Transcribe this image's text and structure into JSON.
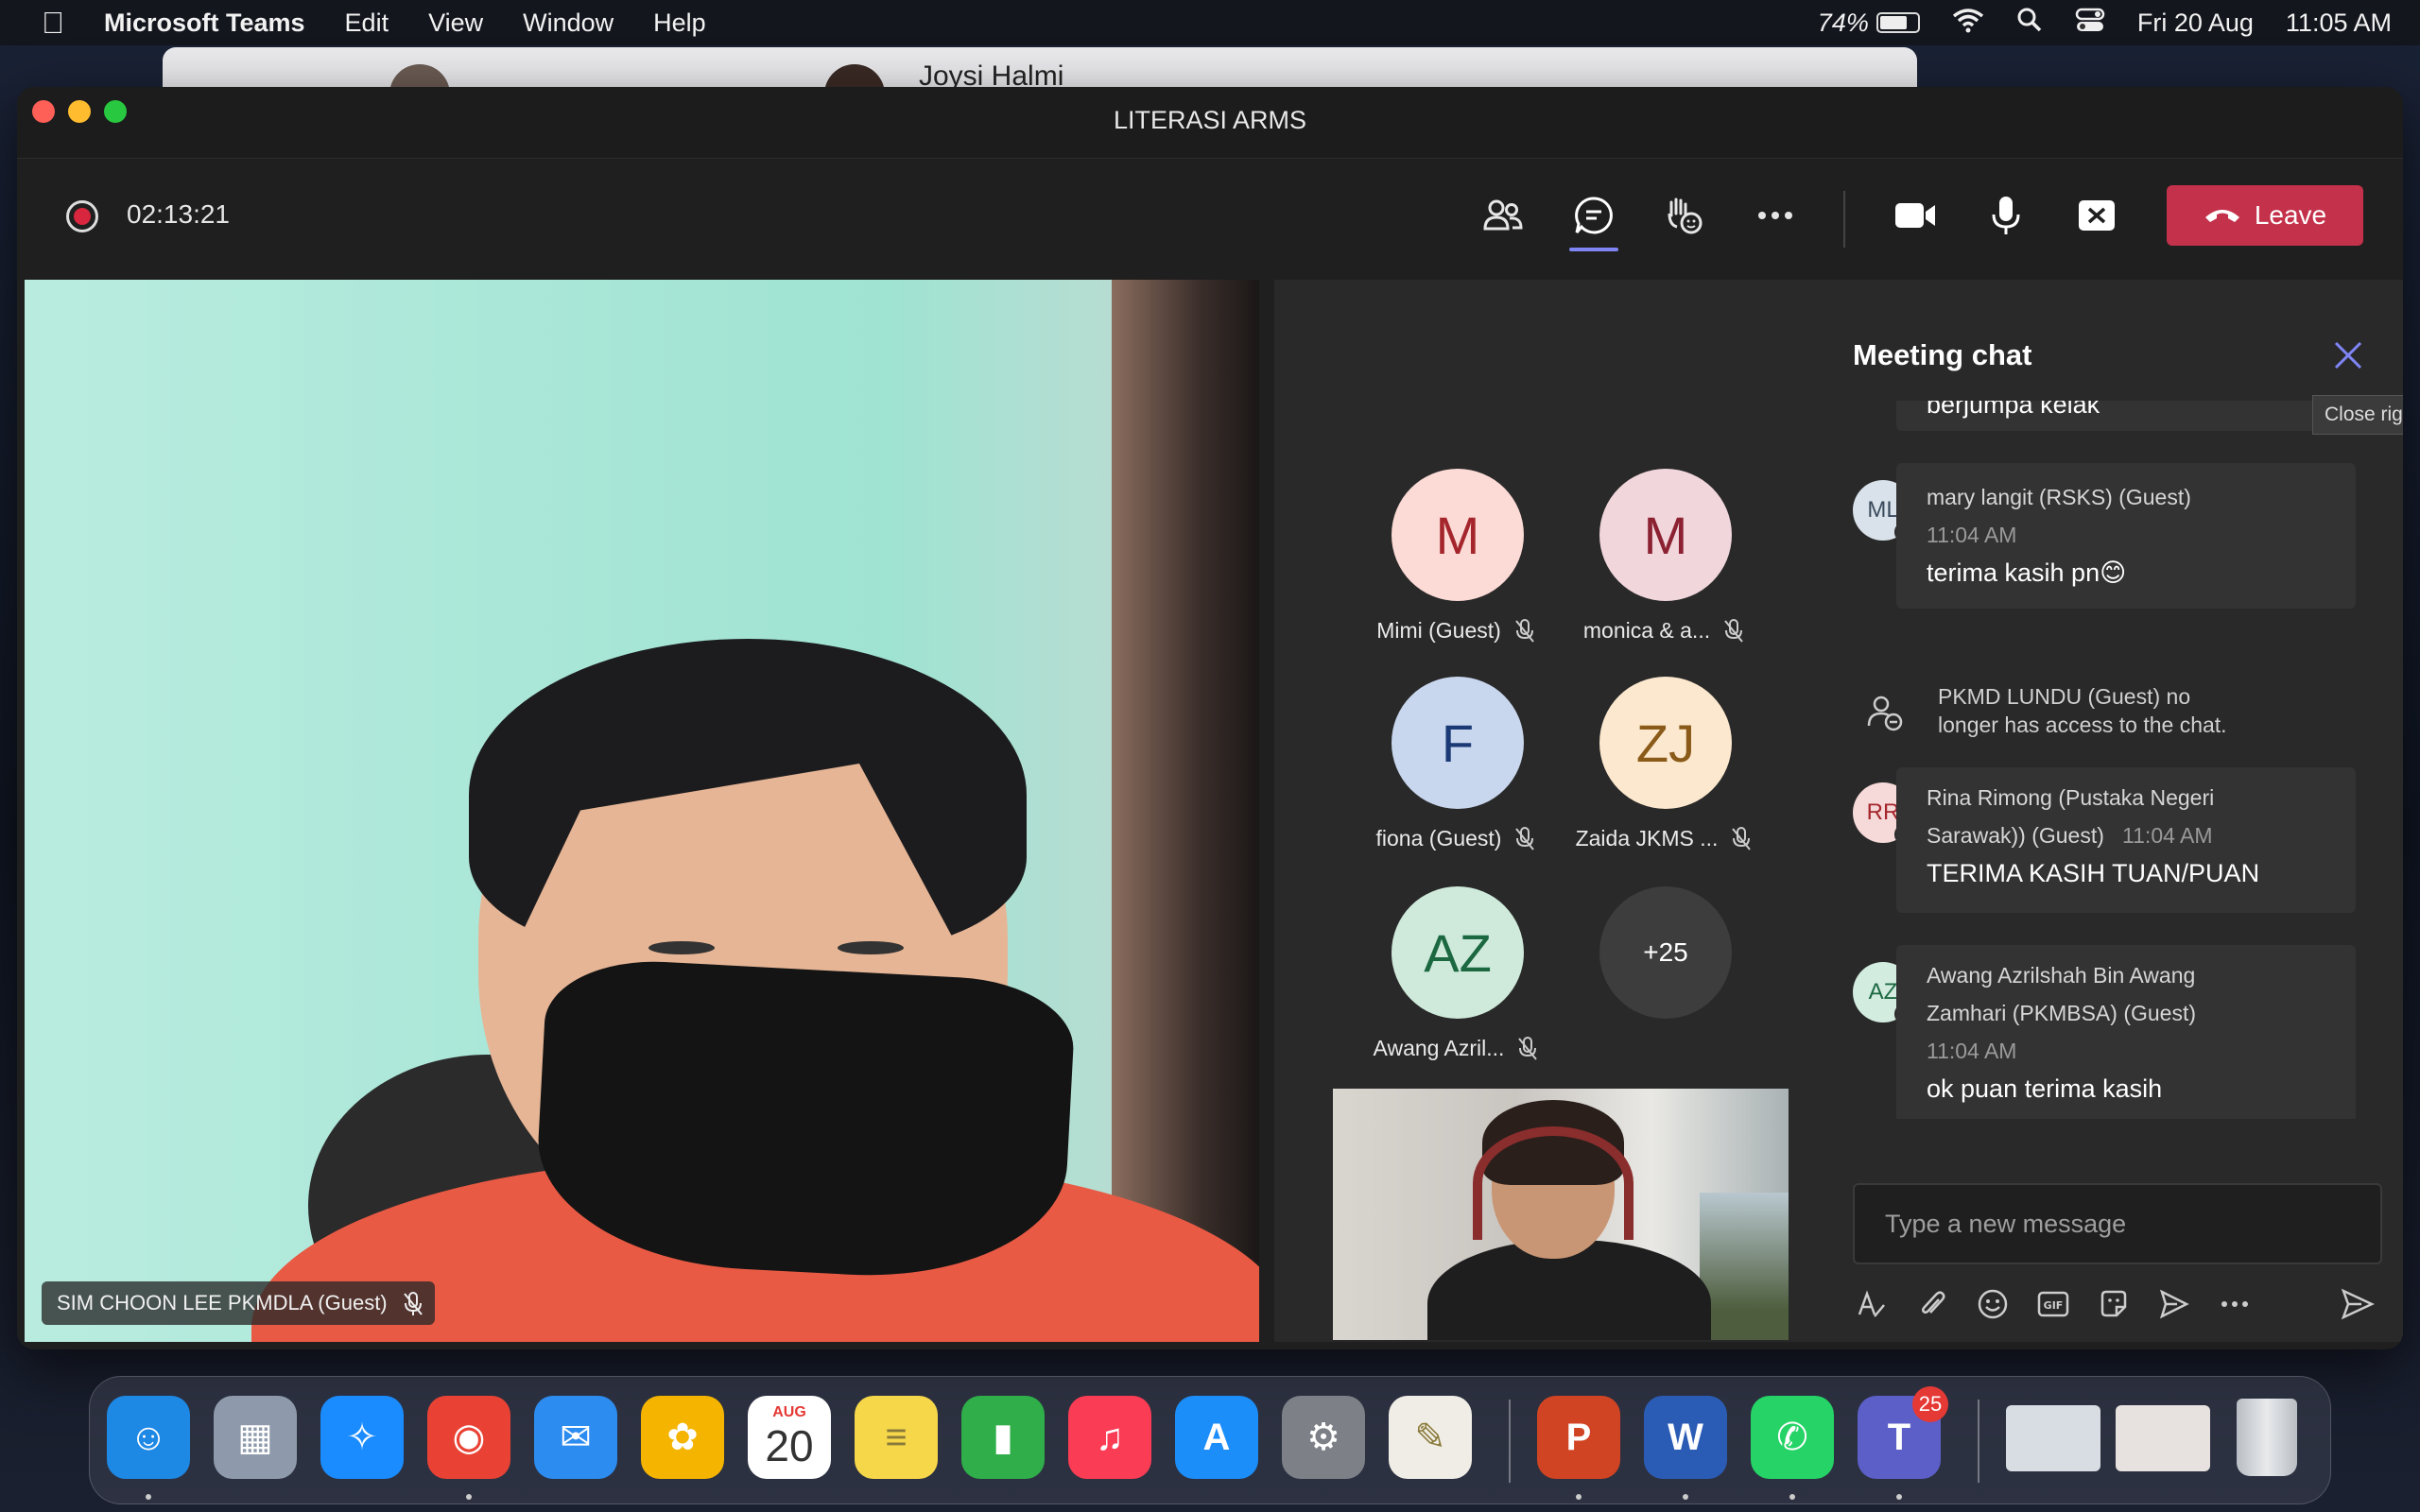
{
  "menubar": {
    "app_name": "Microsoft Teams",
    "menus": [
      "Edit",
      "View",
      "Window",
      "Help"
    ],
    "battery_percent": "74%",
    "battery_level": 0.74,
    "date": "Fri 20 Aug",
    "time": "11:05 AM"
  },
  "background_window": {
    "peek_name": "Joysi Halmi"
  },
  "window": {
    "title": "LITERASI ARMS"
  },
  "toolbar": {
    "recording_time": "02:13:21",
    "leave_label": "Leave",
    "buttons": [
      "people-icon",
      "chat-icon",
      "react-icon",
      "more-icon",
      "camera-icon",
      "mic-icon",
      "share-icon"
    ]
  },
  "main_video": {
    "participant_name": "SIM CHOON LEE PKMDLA (Guest)"
  },
  "gallery": {
    "tiles": [
      {
        "initials": "M",
        "name": "Mimi (Guest)",
        "bg": "#fcdad6",
        "fg": "#a4262c"
      },
      {
        "initials": "M",
        "name": "monica & a...",
        "bg": "#f1d6dc",
        "fg": "#8b2131"
      },
      {
        "initials": "F",
        "name": "fiona (Guest)",
        "bg": "#c9d7ee",
        "fg": "#1b3a75"
      },
      {
        "initials": "ZJ",
        "name": "Zaida JKMS ...",
        "bg": "#fce8ce",
        "fg": "#8a5a19"
      },
      {
        "initials": "AZ",
        "name": "Awang Azril...",
        "bg": "#cfeadb",
        "fg": "#1b6841"
      }
    ],
    "more_count": "+25"
  },
  "chat": {
    "title": "Meeting chat",
    "close_tooltip": "Close right pane",
    "partial_message": "berjumpa kelak",
    "messages": [
      {
        "initials": "ML",
        "sender": "mary langit (RSKS) (Guest)",
        "time": "11:04 AM",
        "text": "terima kasih pn😊",
        "av_bg": "#d9e2ea",
        "av_fg": "#3a4a5c"
      },
      {
        "initials": "RR",
        "sender_line1": "Rina Rimong (Pustaka Negeri",
        "sender_line2": "Sarawak)) (Guest)",
        "time": "11:04 AM",
        "text": "TERIMA KASIH TUAN/PUAN",
        "av_bg": "#f6d9d9",
        "av_fg": "#a4262c"
      },
      {
        "initials": "AZ",
        "sender_line1": "Awang Azrilshah Bin Awang",
        "sender_line2": "Zamhari (PKMBSA) (Guest)",
        "time": "11:04 AM",
        "text": "ok puan terima kasih",
        "av_bg": "#d3ece0",
        "av_fg": "#1b6841"
      }
    ],
    "system_message_line1": "PKMD LUNDU (Guest) no",
    "system_message_line2": "longer has access to the chat.",
    "compose_placeholder": "Type a new message",
    "compose_icons": [
      "format-icon",
      "attach-icon",
      "emoji-icon",
      "gif-icon",
      "sticker-icon",
      "schedule-icon",
      "more-options-icon",
      "send-icon"
    ]
  },
  "dock": {
    "calendar_month": "AUG",
    "calendar_day": "20",
    "teams_badge": "25",
    "apps": [
      {
        "name": "finder-icon",
        "color": "#1e88e5",
        "glyph": "☺"
      },
      {
        "name": "launchpad-icon",
        "color": "#8e9aab",
        "glyph": "▦"
      },
      {
        "name": "safari-icon",
        "color": "#1a8cff",
        "glyph": "✧"
      },
      {
        "name": "chrome-icon",
        "color": "#e94235",
        "glyph": "◉"
      },
      {
        "name": "mail-icon",
        "color": "#2d8cf0",
        "glyph": "✉"
      },
      {
        "name": "photos-icon",
        "color": "#f4b400",
        "glyph": "✿"
      },
      {
        "name": "calendar-icon",
        "color": "#ffffff",
        "glyph": ""
      },
      {
        "name": "notes-icon",
        "color": "#f7d74a",
        "glyph": "≡"
      },
      {
        "name": "numbers-icon",
        "color": "#2fae4a",
        "glyph": "▮"
      },
      {
        "name": "music-icon",
        "color": "#fa3c54",
        "glyph": "♫"
      },
      {
        "name": "app-store-icon",
        "color": "#1c8ef9",
        "glyph": "A"
      },
      {
        "name": "system-preferences-icon",
        "color": "#7d8187",
        "glyph": "⚙"
      },
      {
        "name": "textedit-icon",
        "color": "#f0ede6",
        "glyph": "✎"
      },
      {
        "name": "powerpoint-icon",
        "color": "#d04423",
        "glyph": "P"
      },
      {
        "name": "word-icon",
        "color": "#2b5cb5",
        "glyph": "W"
      },
      {
        "name": "whatsapp-icon",
        "color": "#25d366",
        "glyph": "✆"
      },
      {
        "name": "teams-icon",
        "color": "#5b5fc7",
        "glyph": "T"
      },
      {
        "name": "chrome-window-thumb-icon",
        "color": "#d8dde3",
        "glyph": ""
      },
      {
        "name": "powerpoint-window-thumb-icon",
        "color": "#e7e2df",
        "glyph": ""
      },
      {
        "name": "trash-icon",
        "color": "#c8ccd0",
        "glyph": ""
      }
    ]
  }
}
